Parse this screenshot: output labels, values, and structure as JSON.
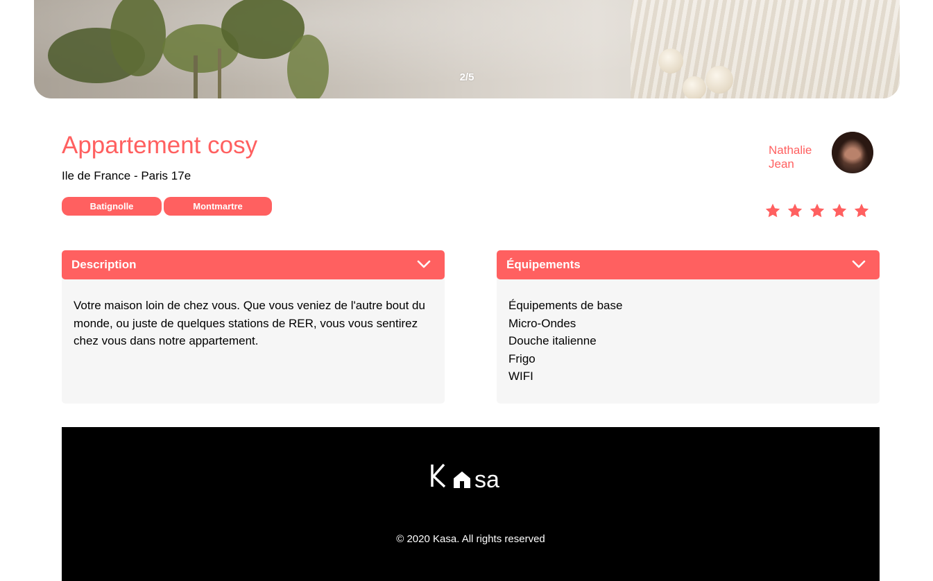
{
  "carousel": {
    "counter": "2/5"
  },
  "listing": {
    "title": "Appartement cosy",
    "location": "Ile de France - Paris 17e",
    "tags": [
      "Batignolle",
      "Montmartre"
    ],
    "rating": 5,
    "rating_max": 5
  },
  "host": {
    "first_name": "Nathalie",
    "last_name": "Jean"
  },
  "description": {
    "header": "Description",
    "text": "Votre maison loin de chez vous. Que vous veniez de l'autre bout du monde, ou juste de quelques stations de RER, vous vous sentirez chez vous dans notre appartement."
  },
  "equipments": {
    "header": "Équipements",
    "items": [
      "Équipements de base",
      "Micro-Ondes",
      "Douche italienne",
      "Frigo",
      "WIFI"
    ]
  },
  "footer": {
    "logo_text": "Kasa",
    "copyright": "© 2020 Kasa. All rights reserved"
  },
  "colors": {
    "accent": "#FF6060",
    "panel": "#F6F6F6",
    "footer_bg": "#000000",
    "star_inactive": "#E3E3E3"
  },
  "icons": [
    "chevron-down-icon",
    "star-icon",
    "house-icon"
  ]
}
